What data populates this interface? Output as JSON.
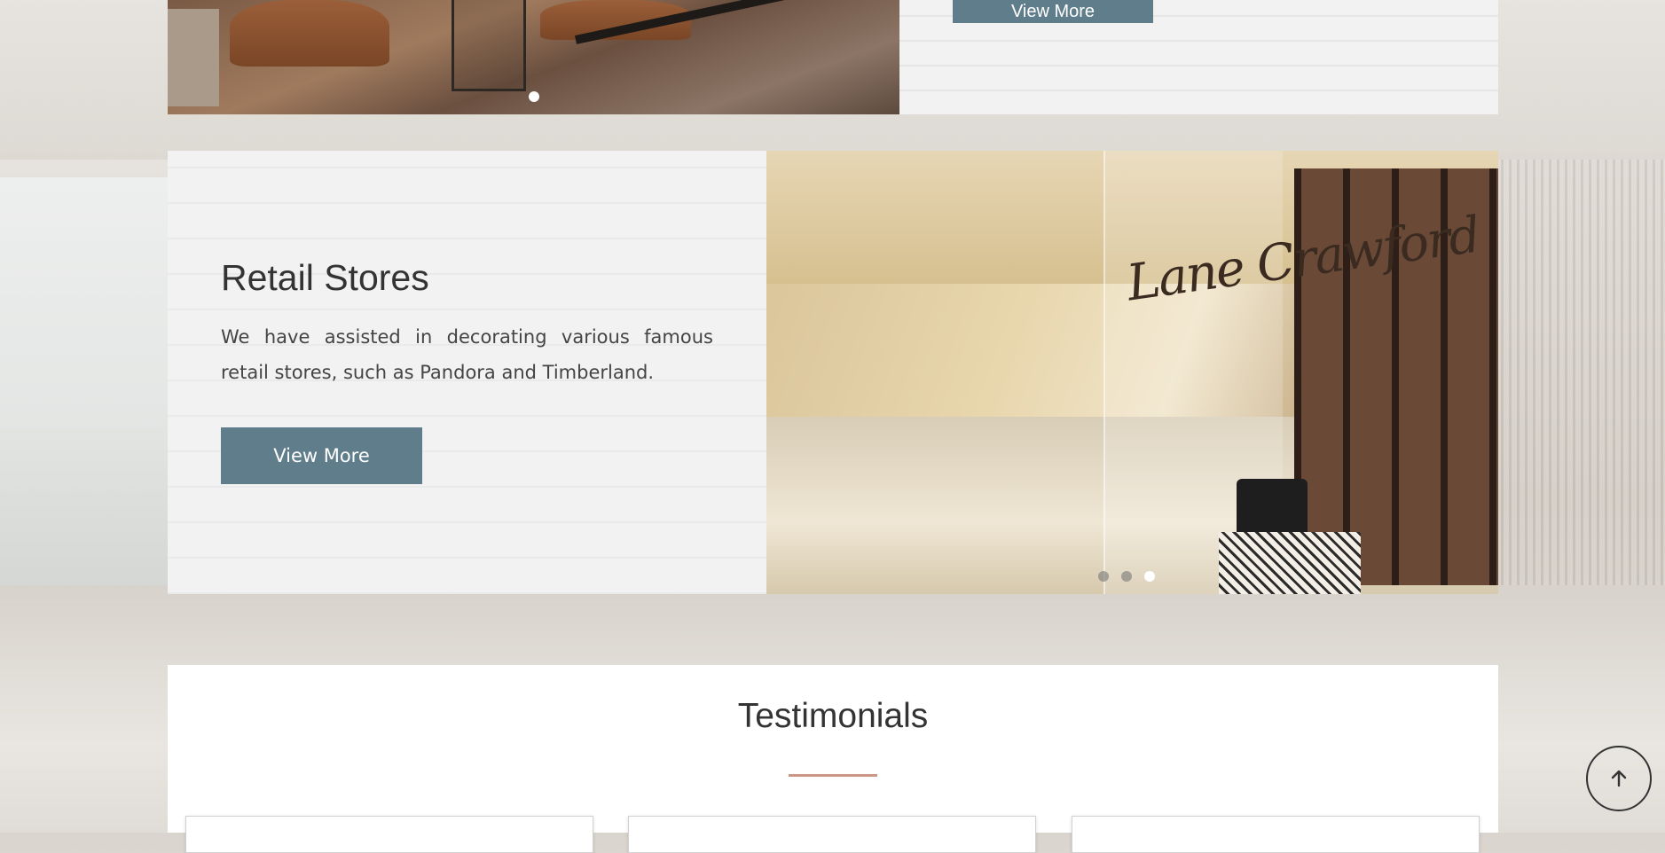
{
  "top_section": {
    "button_label": "View More"
  },
  "retail": {
    "title": "Retail Stores",
    "description": "We have assisted in decorating various famous retail stores, such as Pandora and Timberland.",
    "button_label": "View More",
    "image_signage": "Lane Crawford",
    "slide_count": 3,
    "active_slide": 3
  },
  "testimonials": {
    "title": "Testimonials",
    "accent_color": "#c99784",
    "card_count": 3
  },
  "colors": {
    "button": "#607d8b",
    "accent": "#c99784"
  },
  "icons": {
    "scroll_top": "arrow-up-icon"
  }
}
